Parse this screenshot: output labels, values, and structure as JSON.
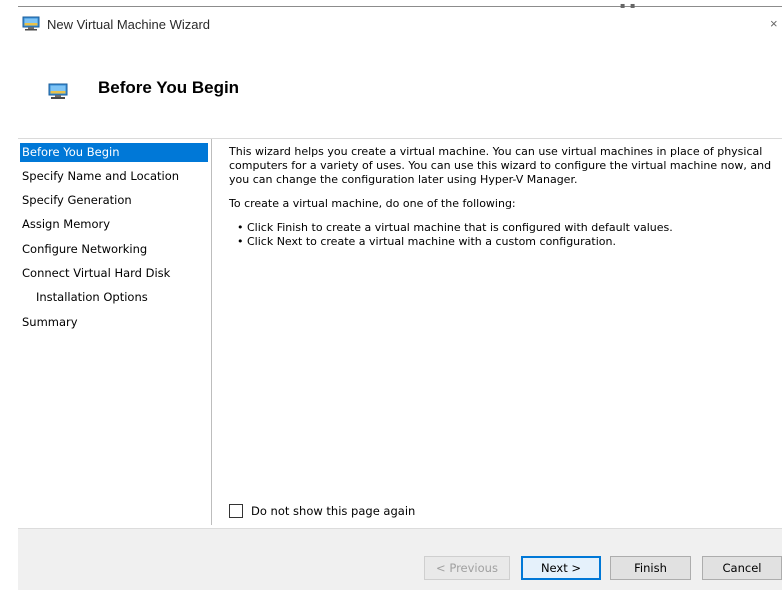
{
  "window": {
    "title": "New Virtual Machine Wizard",
    "close_glyph": "×",
    "top_mark": "▪ ▪"
  },
  "header": {
    "title": "Before You Begin",
    "icon": "virtual-machine-icon"
  },
  "sidebar": {
    "items": [
      {
        "label": "Before You Begin",
        "selected": true
      },
      {
        "label": "Specify Name and Location"
      },
      {
        "label": "Specify Generation"
      },
      {
        "label": "Assign Memory"
      },
      {
        "label": "Configure Networking"
      },
      {
        "label": "Connect Virtual Hard Disk"
      },
      {
        "label": "Installation Options",
        "indent": true
      },
      {
        "label": "Summary"
      }
    ]
  },
  "content": {
    "intro": "This wizard helps you create a virtual machine. You can use virtual machines in place of physical computers for a variety of uses. You can use this wizard to configure the virtual machine now, and you can change the configuration later using Hyper-V Manager.",
    "instruction": "To create a virtual machine, do one of the following:",
    "bullets": [
      "• Click Finish to create a virtual machine that is configured with default values.",
      "• Click Next to create a virtual machine with a custom configuration."
    ]
  },
  "checkbox": {
    "label": "Do not show this page again",
    "checked": false
  },
  "buttons": {
    "previous": "< Previous",
    "next": "Next >",
    "finish": "Finish",
    "cancel": "Cancel"
  },
  "colors": {
    "selection": "#0078d7",
    "footer_bg": "#f0f0f0"
  }
}
